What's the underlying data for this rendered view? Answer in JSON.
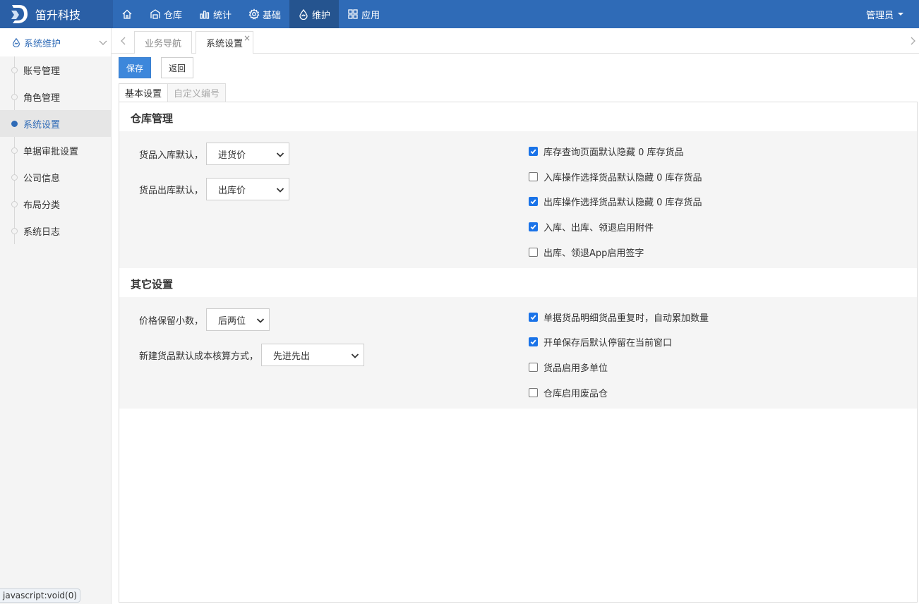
{
  "brand": {
    "name": "笛升科技"
  },
  "nav": {
    "items": [
      {
        "label": "仓库"
      },
      {
        "label": "统计"
      },
      {
        "label": "基础"
      },
      {
        "label": "维护"
      },
      {
        "label": "应用"
      }
    ],
    "user": "管理员"
  },
  "sidebar": {
    "header": "系统维护",
    "items": [
      {
        "label": "账号管理"
      },
      {
        "label": "角色管理"
      },
      {
        "label": "系统设置"
      },
      {
        "label": "单据审批设置"
      },
      {
        "label": "公司信息"
      },
      {
        "label": "布局分类"
      },
      {
        "label": "系统日志"
      }
    ]
  },
  "tabs": {
    "items": [
      {
        "label": "业务导航"
      },
      {
        "label": "系统设置"
      }
    ],
    "close": "×"
  },
  "toolbar": {
    "save_label": "保存",
    "back_label": "返回"
  },
  "panel_tabs": [
    {
      "label": "基本设置"
    },
    {
      "label": "自定义编号"
    }
  ],
  "warehouse": {
    "title": "仓库管理",
    "in_label": "货品入库默认，",
    "in_value": "进货价",
    "out_label": "货品出库默认，",
    "out_value": "出库价",
    "checks": [
      {
        "label": "库存查询页面默认隐藏 0 库存货品",
        "checked": true
      },
      {
        "label": "入库操作选择货品默认隐藏 0 库存货品",
        "checked": false
      },
      {
        "label": "出库操作选择货品默认隐藏 0 库存货品",
        "checked": true
      },
      {
        "label": "入库、出库、领退启用附件",
        "checked": true
      },
      {
        "label": "出库、领退App启用签字",
        "checked": false
      }
    ]
  },
  "other": {
    "title": "其它设置",
    "price_label": "价格保留小数，",
    "price_value": "后两位",
    "cost_label": "新建货品默认成本核算方式，",
    "cost_value": "先进先出",
    "checks": [
      {
        "label": "单据货品明细货品重复时，自动累加数量",
        "checked": true
      },
      {
        "label": "开单保存后默认停留在当前窗口",
        "checked": true
      },
      {
        "label": "货品启用多单位",
        "checked": false
      },
      {
        "label": "仓库启用废品仓",
        "checked": false
      }
    ]
  },
  "status": {
    "text": "javascript:void(0)"
  },
  "colors": {
    "nav": "#2f6bb7",
    "brand": "#2a5fa6",
    "active": "#25548f",
    "primary": "#3d87db"
  }
}
